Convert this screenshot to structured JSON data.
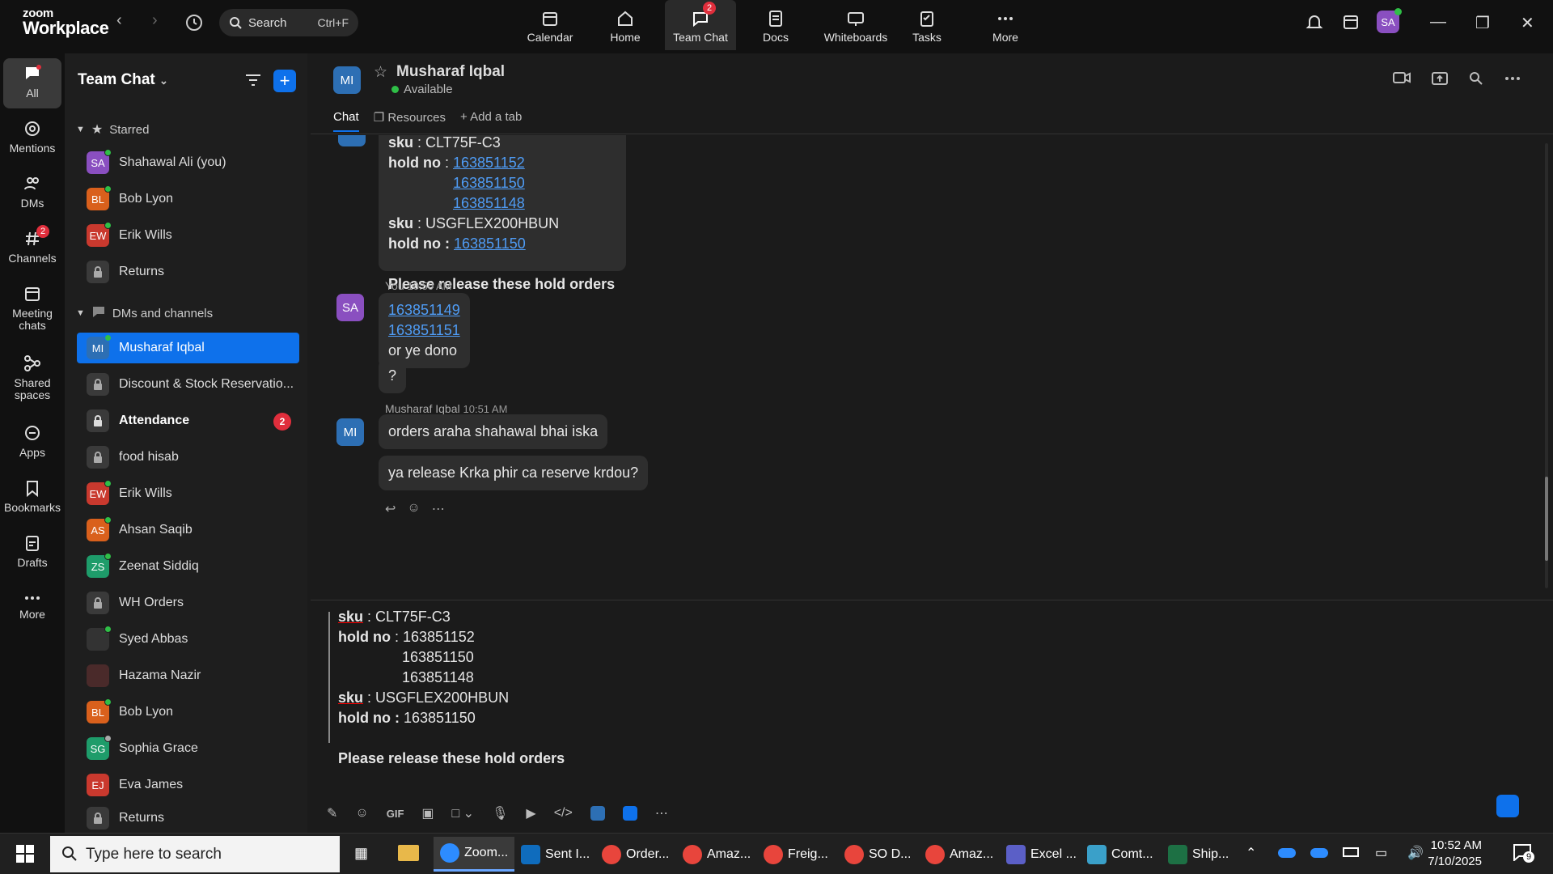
{
  "app": {
    "logo_top": "zoom",
    "logo_bottom": "Workplace"
  },
  "search": {
    "label": "Search",
    "shortcut": "Ctrl+F"
  },
  "topnav": [
    {
      "label": "Calendar"
    },
    {
      "label": "Home"
    },
    {
      "label": "Team Chat",
      "badge": "2"
    },
    {
      "label": "Docs"
    },
    {
      "label": "Whiteboards"
    },
    {
      "label": "Tasks"
    },
    {
      "label": "More"
    }
  ],
  "user_avatar": "SA",
  "rail": [
    {
      "label": "All"
    },
    {
      "label": "Mentions"
    },
    {
      "label": "DMs"
    },
    {
      "label": "Channels",
      "badge": "2"
    },
    {
      "label": "Meeting chats"
    },
    {
      "label": "Shared spaces"
    },
    {
      "label": "Apps"
    },
    {
      "label": "Bookmarks"
    },
    {
      "label": "Drafts"
    },
    {
      "label": "More"
    }
  ],
  "sidebar": {
    "title": "Team Chat",
    "starred_label": "Starred",
    "dms_label": "DMs and channels",
    "starred": [
      {
        "initials": "SA",
        "name": "Shahawal Ali (you)",
        "color": "#8a4fc0"
      },
      {
        "initials": "BL",
        "name": "Bob Lyon",
        "color": "#d9601c"
      },
      {
        "initials": "EW",
        "name": "Erik Wills",
        "color": "#c9392e"
      },
      {
        "lock": true,
        "name": "Returns"
      }
    ],
    "items": [
      {
        "initials": "MI",
        "name": "Musharaf Iqbal",
        "color": "#2d6fb4"
      },
      {
        "lock": true,
        "name": "Discount & Stock Reservatio..."
      },
      {
        "lock": true,
        "name": "Attendance",
        "badge": "2"
      },
      {
        "lock": true,
        "name": "food hisab"
      },
      {
        "initials": "EW",
        "name": "Erik Wills",
        "color": "#c9392e"
      },
      {
        "initials": "AS",
        "name": "Ahsan Saqib",
        "color": "#d9601c"
      },
      {
        "initials": "ZS",
        "name": "Zeenat Siddiq",
        "color": "#1e9c6a"
      },
      {
        "lock": true,
        "name": "WH Orders"
      },
      {
        "initials": "",
        "name": "Syed Abbas",
        "color": "#333"
      },
      {
        "initials": "",
        "name": "Hazama Nazir",
        "color": "#4a2a2a"
      },
      {
        "initials": "BL",
        "name": "Bob Lyon",
        "color": "#d9601c"
      },
      {
        "initials": "SG",
        "name": "Sophia Grace",
        "color": "#1e9c6a"
      },
      {
        "initials": "EJ",
        "name": "Eva James",
        "color": "#c9392e"
      },
      {
        "lock": true,
        "name": "Returns"
      }
    ]
  },
  "chat": {
    "contact_initials": "MI",
    "contact_name": "Musharaf Iqbal",
    "status": "Available",
    "tabs": [
      "Chat",
      "Resources",
      "Add a tab"
    ],
    "msg1": {
      "sku1_label": "sku",
      "sku1": " : CLT75F-C3",
      "hold_label": "hold no",
      "links": [
        "163851152",
        "163851150",
        "163851148"
      ],
      "sku2_label": "sku",
      "sku2": " : USGFLEX200HBUN",
      "hold2_label": "hold no :",
      "link2": "163851150",
      "footer": "Please release these hold orders"
    },
    "msg2": {
      "initials": "SA",
      "sender": "You",
      "time": "10:50 AM",
      "links": [
        "163851149",
        "163851151"
      ],
      "text": "or ye dono",
      "q": "?"
    },
    "msg3": {
      "initials": "MI",
      "sender": "Musharaf Iqbal",
      "time": "10:51 AM",
      "text1": "orders araha shahawal bhai iska",
      "text2": "ya release Krka phir ca reserve krdou?"
    }
  },
  "composer": {
    "sku1_label": "sku",
    "sku1": " : CLT75F-C3",
    "hold_label": "hold no",
    "hold1": " : 163851152",
    "hold2": "163851150",
    "hold3": "163851148",
    "sku2_label": "sku",
    "sku2": "  : USGFLEX200HBUN",
    "hold2_label": "hold no :",
    "hold4": " 163851150",
    "footer": "Please release these hold orders"
  },
  "taskbar": {
    "search_placeholder": "Type here to search",
    "apps": [
      {
        "label": "Zoom...",
        "color": "#2d8cff"
      },
      {
        "label": "Sent I...",
        "color": "#0f6cbd"
      },
      {
        "label": "Order...",
        "color": "#e8453c"
      },
      {
        "label": "Amaz...",
        "color": "#e8453c"
      },
      {
        "label": "Freig...",
        "color": "#e8453c"
      },
      {
        "label": "SO D...",
        "color": "#e8453c"
      },
      {
        "label": "Amaz...",
        "color": "#e8453c"
      },
      {
        "label": "Excel ...",
        "color": "#5b5fc7"
      },
      {
        "label": "Comt...",
        "color": "#3aa0c9"
      },
      {
        "label": "Ship...",
        "color": "#1d7044"
      }
    ],
    "time": "10:52 AM",
    "date": "7/10/2025",
    "notif_count": "9"
  }
}
